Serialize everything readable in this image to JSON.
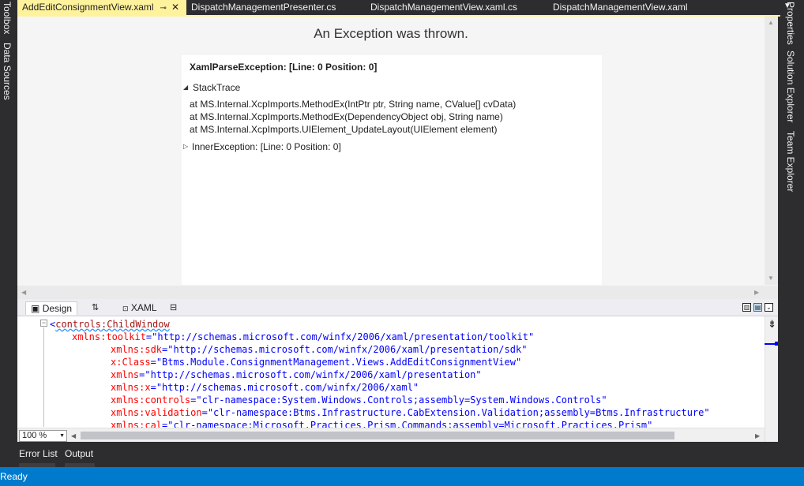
{
  "colors": {
    "ide_background": "#2d2d30",
    "active_tab": "#fff29d",
    "status_bar": "#007acc",
    "xaml_tag": "#a31515",
    "xaml_attribute": "#ff0000",
    "xaml_value": "#0000ff"
  },
  "tabs": [
    {
      "label": "AddEditConsignmentView.xaml",
      "active": true
    },
    {
      "label": "DispatchManagementPresenter.cs",
      "active": false
    },
    {
      "label": "DispatchManagementView.xaml.cs",
      "active": false
    },
    {
      "label": "DispatchManagementView.xaml",
      "active": false
    }
  ],
  "left_strip": [
    "Toolbox",
    "Data Sources"
  ],
  "right_strip": [
    "Properties",
    "Solution Explorer",
    "Team Explorer"
  ],
  "designer": {
    "exception_title": "An Exception was thrown.",
    "exception_header": "XamlParseException:  [Line: 0 Position: 0]",
    "stacktrace_label": "StackTrace",
    "stack_lines": [
      "at MS.Internal.XcpImports.MethodEx(IntPtr ptr, String name, CValue[] cvData)",
      "at MS.Internal.XcpImports.MethodEx(DependencyObject obj, String name)",
      "at MS.Internal.XcpImports.UIElement_UpdateLayout(UIElement element)"
    ],
    "inner_exception": "InnerException:  [Line: 0 Position: 0]"
  },
  "split": {
    "design_label": "Design",
    "swap_icon": "swap-panes-icon",
    "xaml_label": "XAML"
  },
  "code": {
    "open_bracket": "<",
    "root_tag": "controls:ChildWindow",
    "lines": [
      {
        "attr": "xmlns:toolkit",
        "value": "\"http://schemas.microsoft.com/winfx/2006/xaml/presentation/toolkit\""
      },
      {
        "attr": "xmlns:sdk",
        "value": "\"http://schemas.microsoft.com/winfx/2006/xaml/presentation/sdk\""
      },
      {
        "attr": "x:Class",
        "value": "\"Btms.Module.ConsignmentManagement.Views.AddEditConsignmentView\""
      },
      {
        "attr": "xmlns",
        "value": "\"http://schemas.microsoft.com/winfx/2006/xaml/presentation\""
      },
      {
        "attr": "xmlns:x",
        "value": "\"http://schemas.microsoft.com/winfx/2006/xaml\""
      },
      {
        "attr": "xmlns:controls",
        "value": "\"clr-namespace:System.Windows.Controls;assembly=System.Windows.Controls\""
      },
      {
        "attr": "xmlns:validation",
        "value": "\"clr-namespace:Btms.Infrastructure.CabExtension.Validation;assembly=Btms.Infrastructure\""
      },
      {
        "attr": "xmlns:cal",
        "value": "\"clr-namespace:Microsoft.Practices.Prism.Commands;assembly=Microsoft.Practices.Prism\""
      }
    ]
  },
  "editor": {
    "zoom": "100 %"
  },
  "bottom_tabs": [
    "Error List",
    "Output"
  ],
  "status": "Ready"
}
